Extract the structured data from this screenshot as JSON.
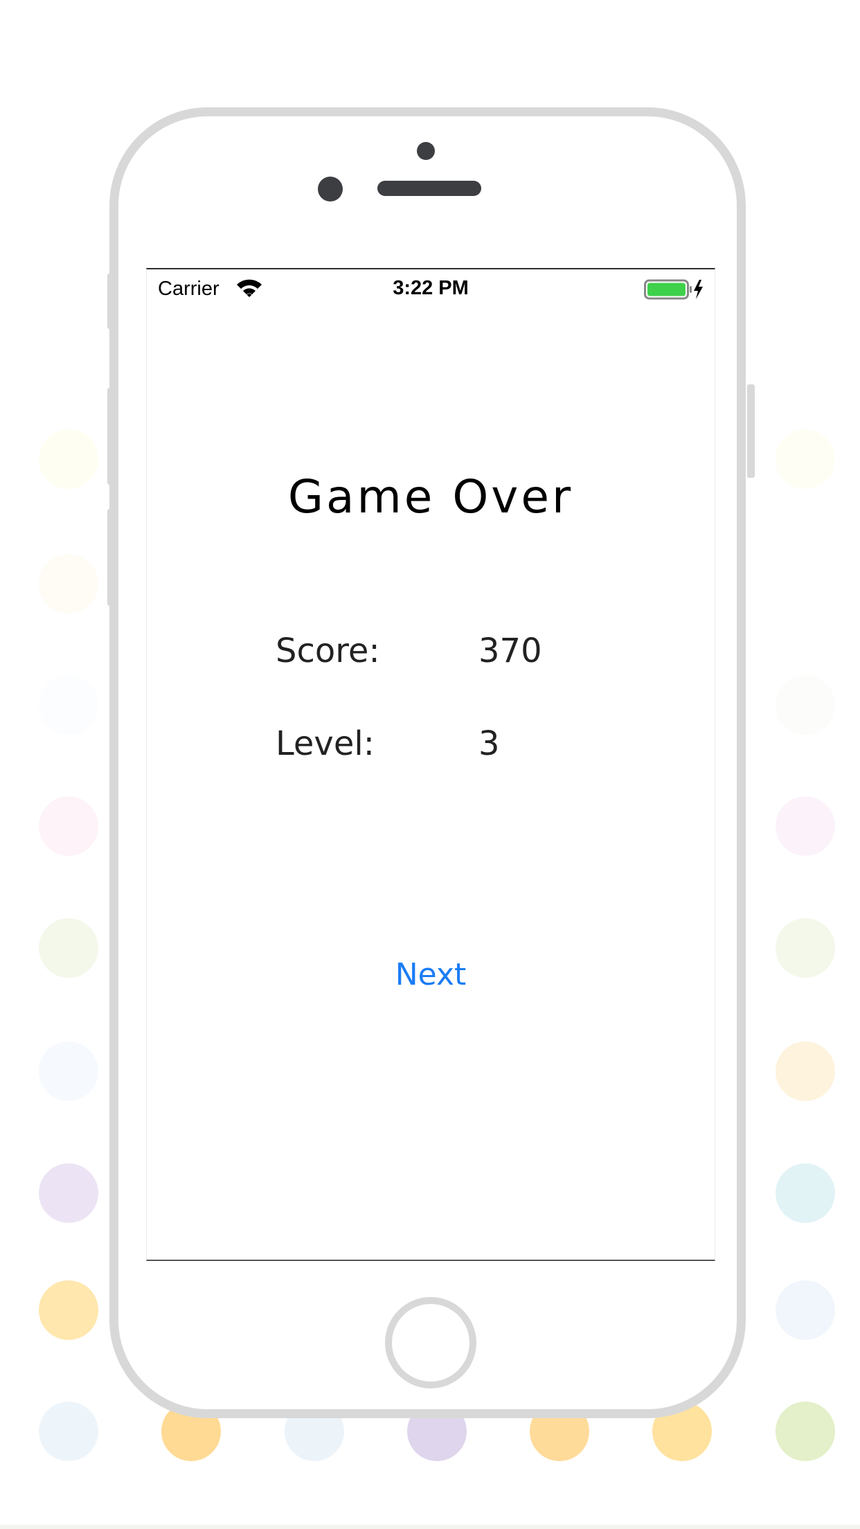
{
  "status_bar": {
    "carrier": "Carrier",
    "time": "3:22 PM",
    "wifi_icon": "wifi-icon",
    "battery_icon": "battery-icon",
    "charging_icon": "lightning-bolt-icon",
    "battery_color": "#3fd14b",
    "battery_level": 1.0
  },
  "game_over": {
    "title": "Game Over",
    "score_label": "Score:",
    "score_value": "370",
    "level_label": "Level:",
    "level_value": "3",
    "next_label": "Next",
    "accent_color": "#1a7cf5"
  },
  "background": {
    "dot_colors": [
      "#ffe7ad",
      "#ffda94",
      "#ecf4fa",
      "#dfd5ec",
      "#e3f0c9",
      "#e7f3f7",
      "#f3eff8",
      "#fdf1fa",
      "#f1f8ea",
      "#fdf3df"
    ]
  }
}
